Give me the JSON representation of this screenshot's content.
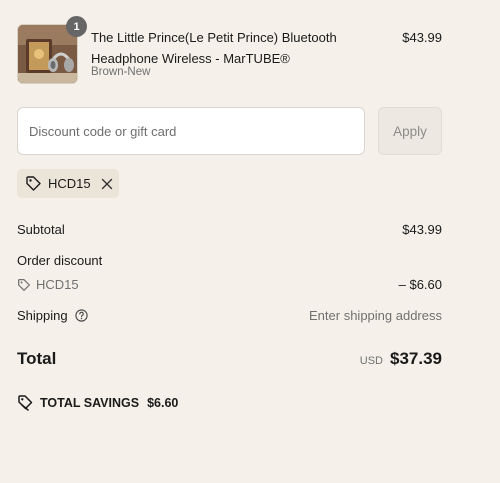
{
  "product": {
    "quantity": "1",
    "title": "The Little Prince(Le Petit Prince) Bluetooth Headphone Wireless - MarTUBE®",
    "variant": "Brown-New",
    "price": "$43.99"
  },
  "discount": {
    "placeholder": "Discount code or gift card",
    "value": "",
    "apply_label": "Apply",
    "applied_code": "HCD15"
  },
  "summary": {
    "subtotal_label": "Subtotal",
    "subtotal_value": "$43.99",
    "order_discount_label": "Order discount",
    "discount_code": "HCD15",
    "discount_value": "– $6.60",
    "shipping_label": "Shipping",
    "shipping_value": "Enter shipping address"
  },
  "total": {
    "label": "Total",
    "currency": "USD",
    "amount": "$37.39"
  },
  "savings": {
    "label": "TOTAL SAVINGS",
    "amount": "$6.60"
  },
  "colors": {
    "background": "#f5f1ea",
    "chip": "#ebe4d8",
    "badge": "#666666"
  },
  "icons": [
    "tag-icon",
    "close-icon",
    "help-circle-icon",
    "savings-tag-icon"
  ]
}
